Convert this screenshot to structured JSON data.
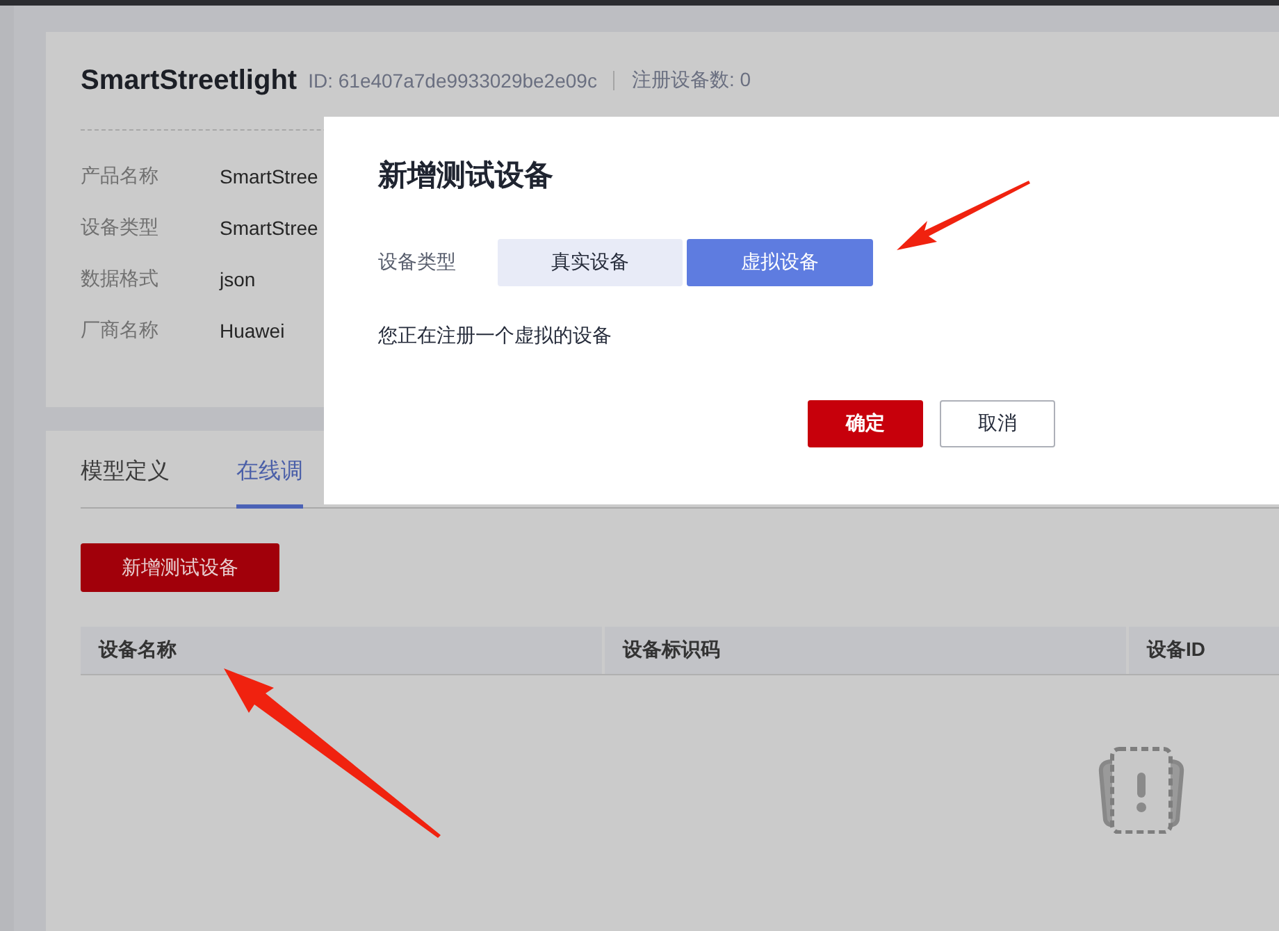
{
  "product": {
    "name": "SmartStreetlight",
    "id": "ID: 61e407a7de9933029be2e09c",
    "device_count": "注册设备数: 0"
  },
  "details": [
    {
      "label": "产品名称",
      "value": "SmartStree"
    },
    {
      "label": "设备类型",
      "value": "SmartStree"
    },
    {
      "label": "数据格式",
      "value": "json"
    },
    {
      "label": "厂商名称",
      "value": "Huawei"
    }
  ],
  "tabs": [
    {
      "label": "模型定义",
      "selected": false
    },
    {
      "label": "在线调",
      "selected": true
    }
  ],
  "add_button": "新增测试设备",
  "table": {
    "columns": [
      "设备名称",
      "设备标识码",
      "设备ID"
    ]
  },
  "dialog": {
    "title": "新增测试设备",
    "type_label": "设备类型",
    "options": [
      {
        "label": "真实设备",
        "selected": false
      },
      {
        "label": "虚拟设备",
        "selected": true
      }
    ],
    "hint": "您正在注册一个虚拟的设备",
    "buttons": [
      {
        "label": "确定",
        "kind": "primary"
      },
      {
        "label": "取消",
        "kind": "secondary"
      }
    ]
  }
}
